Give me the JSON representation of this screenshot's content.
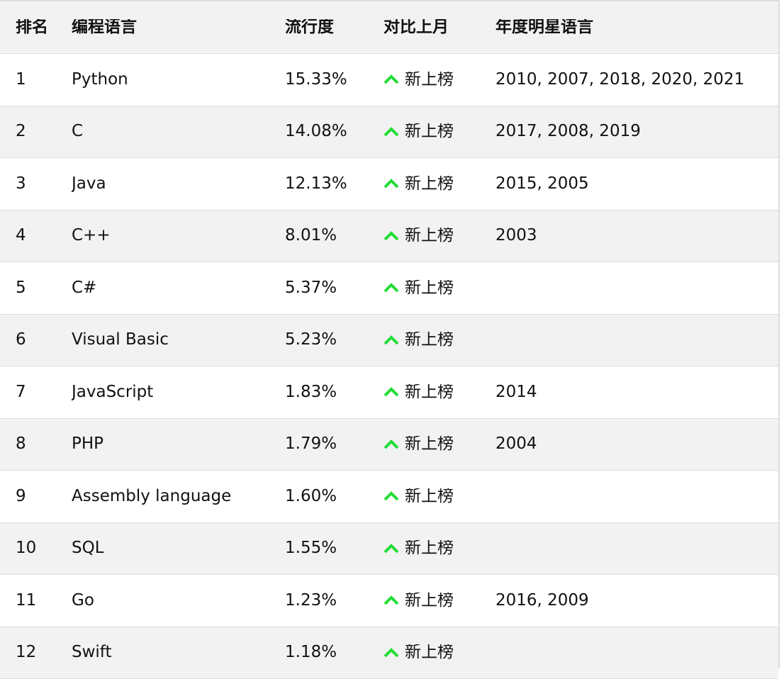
{
  "table": {
    "headers": {
      "rank": "排名",
      "language": "编程语言",
      "popularity": "流行度",
      "vs_last_month": "对比上月",
      "star_years": "年度明星语言"
    },
    "trend_color": "#22dd33",
    "rows": [
      {
        "rank": "1",
        "language": "Python",
        "popularity": "15.33%",
        "trend": "新上榜",
        "trend_icon": "arrow-up-icon",
        "star_years": "2010, 2007, 2018, 2020, 2021"
      },
      {
        "rank": "2",
        "language": "C",
        "popularity": "14.08%",
        "trend": "新上榜",
        "trend_icon": "arrow-up-icon",
        "star_years": "2017, 2008, 2019"
      },
      {
        "rank": "3",
        "language": "Java",
        "popularity": "12.13%",
        "trend": "新上榜",
        "trend_icon": "arrow-up-icon",
        "star_years": "2015, 2005"
      },
      {
        "rank": "4",
        "language": "C++",
        "popularity": "8.01%",
        "trend": "新上榜",
        "trend_icon": "arrow-up-icon",
        "star_years": "2003"
      },
      {
        "rank": "5",
        "language": "C#",
        "popularity": "5.37%",
        "trend": "新上榜",
        "trend_icon": "arrow-up-icon",
        "star_years": ""
      },
      {
        "rank": "6",
        "language": "Visual Basic",
        "popularity": "5.23%",
        "trend": "新上榜",
        "trend_icon": "arrow-up-icon",
        "star_years": ""
      },
      {
        "rank": "7",
        "language": "JavaScript",
        "popularity": "1.83%",
        "trend": "新上榜",
        "trend_icon": "arrow-up-icon",
        "star_years": "2014"
      },
      {
        "rank": "8",
        "language": "PHP",
        "popularity": "1.79%",
        "trend": "新上榜",
        "trend_icon": "arrow-up-icon",
        "star_years": "2004"
      },
      {
        "rank": "9",
        "language": "Assembly language",
        "popularity": "1.60%",
        "trend": "新上榜",
        "trend_icon": "arrow-up-icon",
        "star_years": ""
      },
      {
        "rank": "10",
        "language": "SQL",
        "popularity": "1.55%",
        "trend": "新上榜",
        "trend_icon": "arrow-up-icon",
        "star_years": ""
      },
      {
        "rank": "11",
        "language": "Go",
        "popularity": "1.23%",
        "trend": "新上榜",
        "trend_icon": "arrow-up-icon",
        "star_years": "2016, 2009"
      },
      {
        "rank": "12",
        "language": "Swift",
        "popularity": "1.18%",
        "trend": "新上榜",
        "trend_icon": "arrow-up-icon",
        "star_years": ""
      }
    ]
  }
}
